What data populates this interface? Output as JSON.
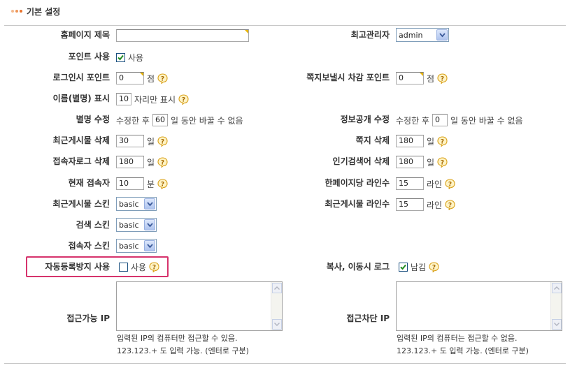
{
  "section": {
    "title": "기본 설정"
  },
  "rows": {
    "homepage_title": {
      "label": "홈페이지 제목",
      "value": ""
    },
    "super_admin": {
      "label": "최고관리자",
      "selected": "admin"
    },
    "point_use": {
      "label": "포인트 사용",
      "checkbox_label": "사용",
      "checked": true
    },
    "login_point": {
      "label": "로그인시 포인트",
      "value": "0",
      "unit": "점"
    },
    "memo_point": {
      "label": "쪽지보낼시 차감 포인트",
      "value": "0",
      "unit": "점"
    },
    "name_display": {
      "label": "이름(별명) 표시",
      "value": "10",
      "suffix": "자리만 표시"
    },
    "nick_modify": {
      "label": "별명 수정",
      "prefix": "수정한 후",
      "value": "60",
      "suffix": "일 동안 바꿀 수 없음"
    },
    "open_modify": {
      "label": "정보공개 수정",
      "prefix": "수정한 후",
      "value": "0",
      "suffix": "일 동안 바꿀 수 없음"
    },
    "new_del": {
      "label": "최근게시물 삭제",
      "value": "30",
      "unit": "일"
    },
    "memo_del": {
      "label": "쪽지 삭제",
      "value": "180",
      "unit": "일"
    },
    "visit_del": {
      "label": "접속자로그 삭제",
      "value": "180",
      "unit": "일"
    },
    "popular_del": {
      "label": "인기검색어 삭제",
      "value": "180",
      "unit": "일"
    },
    "login_minutes": {
      "label": "현재 접속자",
      "value": "10",
      "unit": "분"
    },
    "page_rows": {
      "label": "한페이지당 라인수",
      "value": "15",
      "unit": "라인"
    },
    "new_skin": {
      "label": "최근게시물 스킨",
      "selected": "basic"
    },
    "new_rows": {
      "label": "최근게시물 라인수",
      "value": "15",
      "unit": "라인"
    },
    "search_skin": {
      "label": "검색 스킨",
      "selected": "basic"
    },
    "connect_skin": {
      "label": "접속자 스킨",
      "selected": "basic"
    },
    "captcha": {
      "label": "자동등록방지 사용",
      "checkbox_label": "사용",
      "checked": false
    },
    "copy_log": {
      "label": "복사, 이동시 로그",
      "checkbox_label": "남김",
      "checked": true
    },
    "possible_ip": {
      "label": "접근가능 IP",
      "value": "",
      "help1": "입력된 IP의 컴퓨터만 접근할 수 있음.",
      "help2": "123.123.+ 도 입력 가능. (엔터로 구분)"
    },
    "intercept_ip": {
      "label": "접근차단 IP",
      "value": "",
      "help1": "입력된 IP의 컴퓨터는 접근할 수 없음.",
      "help2": "123.123.+ 도 입력 가능. (엔터로 구분)"
    }
  },
  "colors": {
    "accent_dots": "#e8732c",
    "highlight_border": "#d6336c",
    "help_icon": "#e0a020",
    "select_border": "#7f9db9"
  },
  "icons": {
    "help": "question-mark-bubble-icon",
    "select": "chevron-down-icon",
    "check": "checkmark-icon"
  }
}
